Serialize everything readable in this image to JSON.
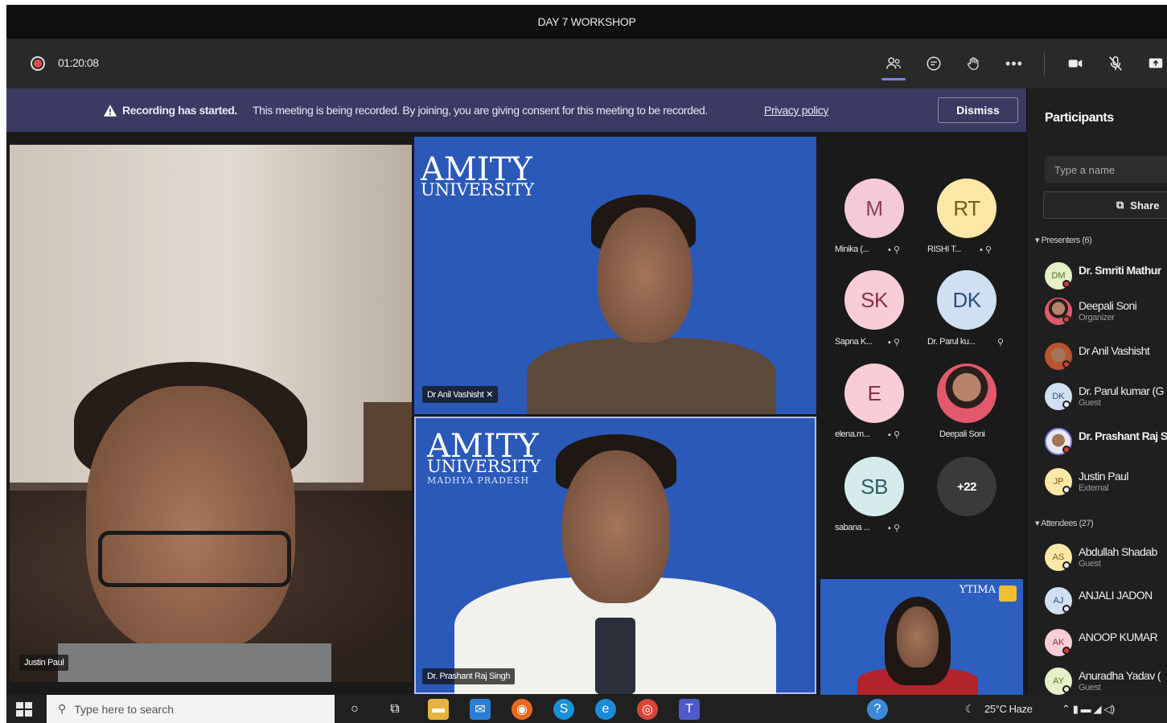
{
  "window": {
    "title": "DAY 7 WORKSHOP"
  },
  "toolbar": {
    "elapsed": "01:20:08"
  },
  "banner": {
    "title": "Recording has started.",
    "text": "This meeting is being recorded. By joining, you are giving consent for this meeting to be recorded.",
    "link": "Privacy policy",
    "dismiss": "Dismiss"
  },
  "stage": {
    "tiles": {
      "justin": "Justin Paul",
      "anil": "Dr Anil Vashisht",
      "prashant": "Dr. Prashant Raj Singh"
    },
    "logos": {
      "anil": {
        "line1": "AMITY",
        "line2": "UNIVERSITY"
      },
      "prashant": {
        "line1": "AMITY",
        "line2": "UNIVERSITY",
        "line3": "MADHYA PRADESH"
      }
    },
    "avatars": [
      {
        "initials": "M",
        "label": "Minika (..."
      },
      {
        "initials": "RT",
        "label": "RISHI T..."
      },
      {
        "initials": "SK",
        "label": "Sapna K..."
      },
      {
        "initials": "DK",
        "label": "Dr. Parul ku..."
      },
      {
        "initials": "E",
        "label": "elena.m..."
      },
      {
        "initials": "",
        "label": "Deepali Soni"
      },
      {
        "initials": "SB",
        "label": "sabana ..."
      },
      {
        "initials": "+22",
        "label": ""
      }
    ],
    "deepali_logo": "YTIMA"
  },
  "panel": {
    "title": "Participants",
    "search_placeholder": "Type a name",
    "share": "Share",
    "presenters_header": "Presenters (6)",
    "attendees_header": "Attendees (27)",
    "presenters": [
      {
        "initials": "DM",
        "name": "Dr. Smriti Mathur",
        "role": ""
      },
      {
        "initials": "",
        "name": "Deepali Soni",
        "role": "Organizer"
      },
      {
        "initials": "",
        "name": "Dr Anil Vashisht",
        "role": ""
      },
      {
        "initials": "DK",
        "name": "Dr. Parul kumar (G",
        "role": "Guest"
      },
      {
        "initials": "",
        "name": "Dr. Prashant Raj S",
        "role": ""
      },
      {
        "initials": "JP",
        "name": "Justin Paul",
        "role": "External"
      }
    ],
    "attendees": [
      {
        "initials": "AS",
        "name": "Abdullah Shadab",
        "role": "Guest"
      },
      {
        "initials": "AJ",
        "name": "ANJALI JADON",
        "role": ""
      },
      {
        "initials": "AK",
        "name": "ANOOP KUMAR",
        "role": ""
      },
      {
        "initials": "AY",
        "name": "Anuradha Yadav (",
        "role": "Guest"
      }
    ]
  },
  "taskbar": {
    "search_placeholder": "Type here to search",
    "weather": "25°C  Haze"
  },
  "colors": {
    "accent": "#7b83eb",
    "banner": "#3b3a63",
    "amity_blue": "#2b59b8"
  }
}
